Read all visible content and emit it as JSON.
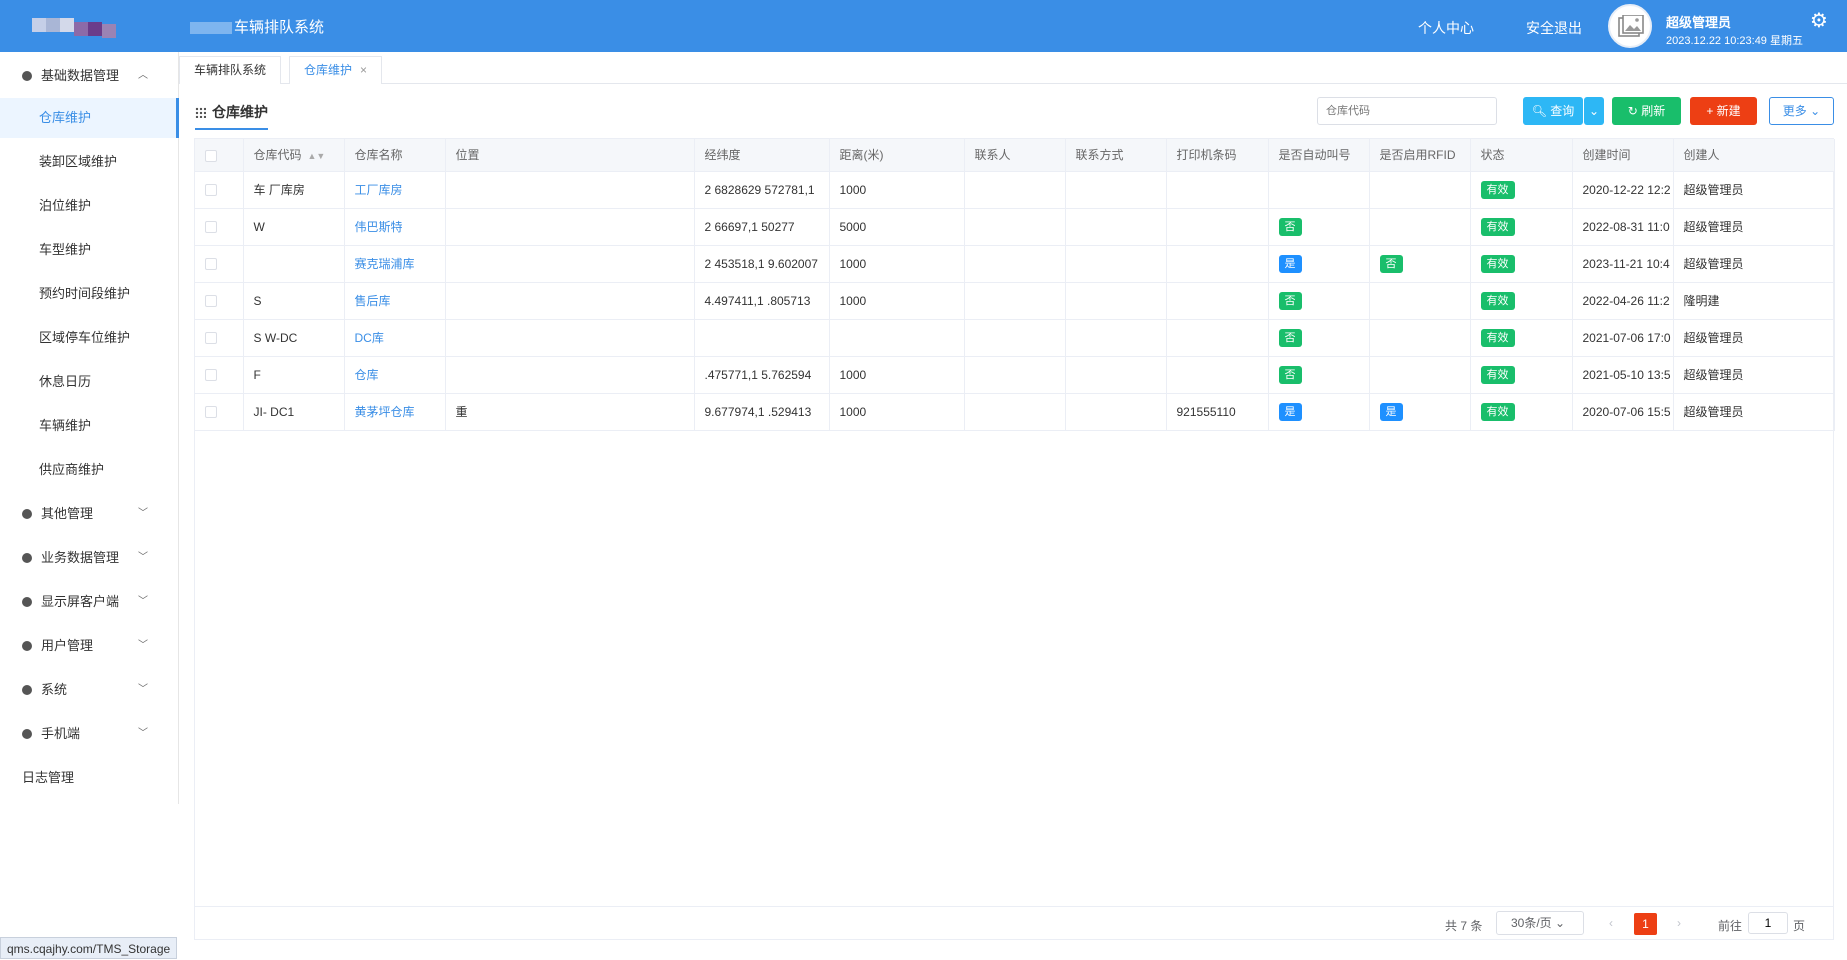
{
  "header": {
    "app_title": "车辆排队系统",
    "personal_center": "个人中心",
    "logout": "安全退出",
    "user_name": "超级管理员",
    "datetime": "2023.12.22 10:23:49 星期五"
  },
  "sidebar": {
    "group_basic": "基础数据管理",
    "sub_items": [
      "仓库维护",
      "装卸区域维护",
      "泊位维护",
      "车型维护",
      "预约时间段维护",
      "区域停车位维护",
      "休息日历",
      "车辆维护",
      "供应商维护"
    ],
    "groups": [
      "其他管理",
      "业务数据管理",
      "显示屏客户端",
      "用户管理",
      "系统",
      "手机端"
    ],
    "log": "日志管理"
  },
  "tabs": [
    "车辆排队系统",
    "仓库维护"
  ],
  "toolbar": {
    "title": "仓库维护",
    "search_placeholder": "仓库代码",
    "query": "查询",
    "refresh": "刷新",
    "new": "新建",
    "more": "更多"
  },
  "table": {
    "headers": [
      "仓库代码",
      "仓库名称",
      "位置",
      "经纬度",
      "距离(米)",
      "联系人",
      "联系方式",
      "打印机条码",
      "是否自动叫号",
      "是否启用RFID",
      "状态",
      "创建时间",
      "创建人"
    ],
    "rows": [
      {
        "code": "车 厂库房",
        "name": "工厂库房",
        "loc": "",
        "lnglat": "2 6828629 572781,1",
        "dist": "1000",
        "contact": "",
        "phone": "",
        "printer": "",
        "auto": "",
        "rfid": "",
        "status": "有效",
        "created": "2020-12-22 12:2",
        "creator": "超级管理员"
      },
      {
        "code": "W",
        "name": "伟巴斯特",
        "loc": "",
        "lnglat": "2 66697,1 50277",
        "dist": "5000",
        "contact": "",
        "phone": "",
        "printer": "",
        "auto": "否",
        "rfid": "",
        "status": "有效",
        "created": "2022-08-31 11:0",
        "creator": "超级管理员"
      },
      {
        "code": "",
        "name": "赛克瑞浦库",
        "loc": "",
        "lnglat": "2 453518,1 9.602007",
        "dist": "1000",
        "contact": "",
        "phone": "",
        "printer": "",
        "auto": "是",
        "rfid": "否",
        "status": "有效",
        "created": "2023-11-21 10:4",
        "creator": "超级管理员"
      },
      {
        "code": "S",
        "name": "售后库",
        "loc": "",
        "lnglat": "4.497411,1 .805713",
        "dist": "1000",
        "contact": "",
        "phone": "",
        "printer": "",
        "auto": "否",
        "rfid": "",
        "status": "有效",
        "created": "2022-04-26 11:2",
        "creator": "隆明建"
      },
      {
        "code": "S W-DC",
        "name": "DC库",
        "loc": "",
        "lnglat": "",
        "dist": "",
        "contact": "",
        "phone": "",
        "printer": "",
        "auto": "否",
        "rfid": "",
        "status": "有效",
        "created": "2021-07-06 17:0",
        "creator": "超级管理员"
      },
      {
        "code": "F",
        "name": "仓库",
        "loc": "",
        "lnglat": ".475771,1 5.762594",
        "dist": "1000",
        "contact": "",
        "phone": "",
        "printer": "",
        "auto": "否",
        "rfid": "",
        "status": "有效",
        "created": "2021-05-10 13:5",
        "creator": "超级管理员"
      },
      {
        "code": "JI- DC1",
        "name": "黄茅坪仓库",
        "loc": "重",
        "lnglat": "9.677974,1 .529413",
        "dist": "1000",
        "contact": "",
        "phone": "",
        "printer": "921555110",
        "auto": "是",
        "rfid": "是",
        "status": "有效",
        "created": "2020-07-06 15:5",
        "creator": "超级管理员"
      }
    ]
  },
  "pager": {
    "total": "共 7 条",
    "page_size": "30条/页",
    "current": "1",
    "goto": "前往",
    "goto_value": "1",
    "page_unit": "页"
  },
  "status_url": "qms.cqajhy.com/TMS_Storage",
  "colors": {
    "header": "#3a8ee6",
    "query": "#2db7f5",
    "refresh": "#19be6b",
    "new": "#ed3f14"
  }
}
